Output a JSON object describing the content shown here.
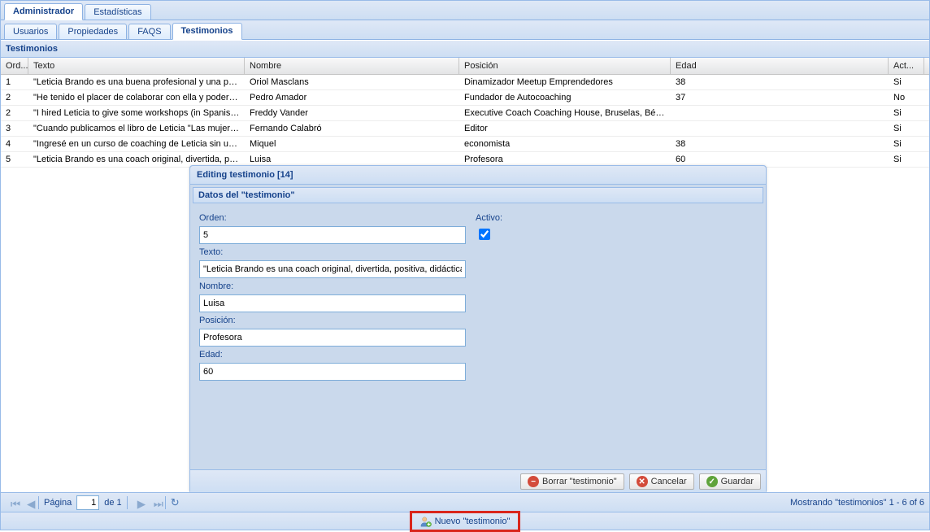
{
  "topTabs": {
    "admin": "Administrador",
    "stats": "Estadísticas"
  },
  "subTabs": {
    "usuarios": "Usuarios",
    "propiedades": "Propiedades",
    "faqs": "FAQS",
    "testimonios": "Testimonios"
  },
  "panelTitle": "Testimonios",
  "columns": {
    "orden": "Ord...",
    "texto": "Texto",
    "nombre": "Nombre",
    "posicion": "Posición",
    "edad": "Edad",
    "activo": "Act..."
  },
  "rows": [
    {
      "orden": "1",
      "texto": "\"Leticia Brando es una buena profesional y una per...",
      "nombre": "Oriol Masclans",
      "posicion": "Dinamizador Meetup Emprendedores",
      "edad": "38",
      "activo": "Si"
    },
    {
      "orden": "2",
      "texto": "\"He tenido el placer de colaborar con ella y poder a...",
      "nombre": "Pedro Amador",
      "posicion": "Fundador de Autocoaching",
      "edad": "37",
      "activo": "No"
    },
    {
      "orden": "2",
      "texto": "\"I hired Leticia to give some workshops (in Spanish) ...",
      "nombre": "Freddy Vander",
      "posicion": "Executive Coach Coaching House, Bruselas, Bélgica",
      "edad": "",
      "activo": "Si"
    },
    {
      "orden": "3",
      "texto": "\"Cuando publicamos el libro de Leticia \"Las mujere...",
      "nombre": "Fernando Calabró",
      "posicion": "Editor",
      "edad": "",
      "activo": "Si"
    },
    {
      "orden": "4",
      "texto": "\"Ingresé en un curso de coaching de Leticia sin una...",
      "nombre": "Miquel",
      "posicion": "economista",
      "edad": "38",
      "activo": "Si"
    },
    {
      "orden": "5",
      "texto": "\"Leticia Brando es una coach original, divertida, po...",
      "nombre": "Luisa",
      "posicion": "Profesora",
      "edad": "60",
      "activo": "Si"
    }
  ],
  "edit": {
    "title": "Editing testimonio [14]",
    "fieldset": "Datos del \"testimonio\"",
    "labels": {
      "orden": "Orden:",
      "activo": "Activo:",
      "texto": "Texto:",
      "nombre": "Nombre:",
      "posicion": "Posición:",
      "edad": "Edad:"
    },
    "values": {
      "orden": "5",
      "activo": true,
      "texto": "\"Leticia Brando es una coach original, divertida, positiva, didáctica, profun",
      "nombre": "Luisa",
      "posicion": "Profesora",
      "edad": "60"
    },
    "buttons": {
      "delete": "Borrar \"testimonio\"",
      "cancel": "Cancelar",
      "save": "Guardar"
    }
  },
  "paging": {
    "pageLabel": "Página",
    "pageValue": "1",
    "ofLabel": "de 1",
    "status": "Mostrando \"testimonios\" 1 - 6 of 6"
  },
  "newButton": "Nuevo \"testimonio\""
}
